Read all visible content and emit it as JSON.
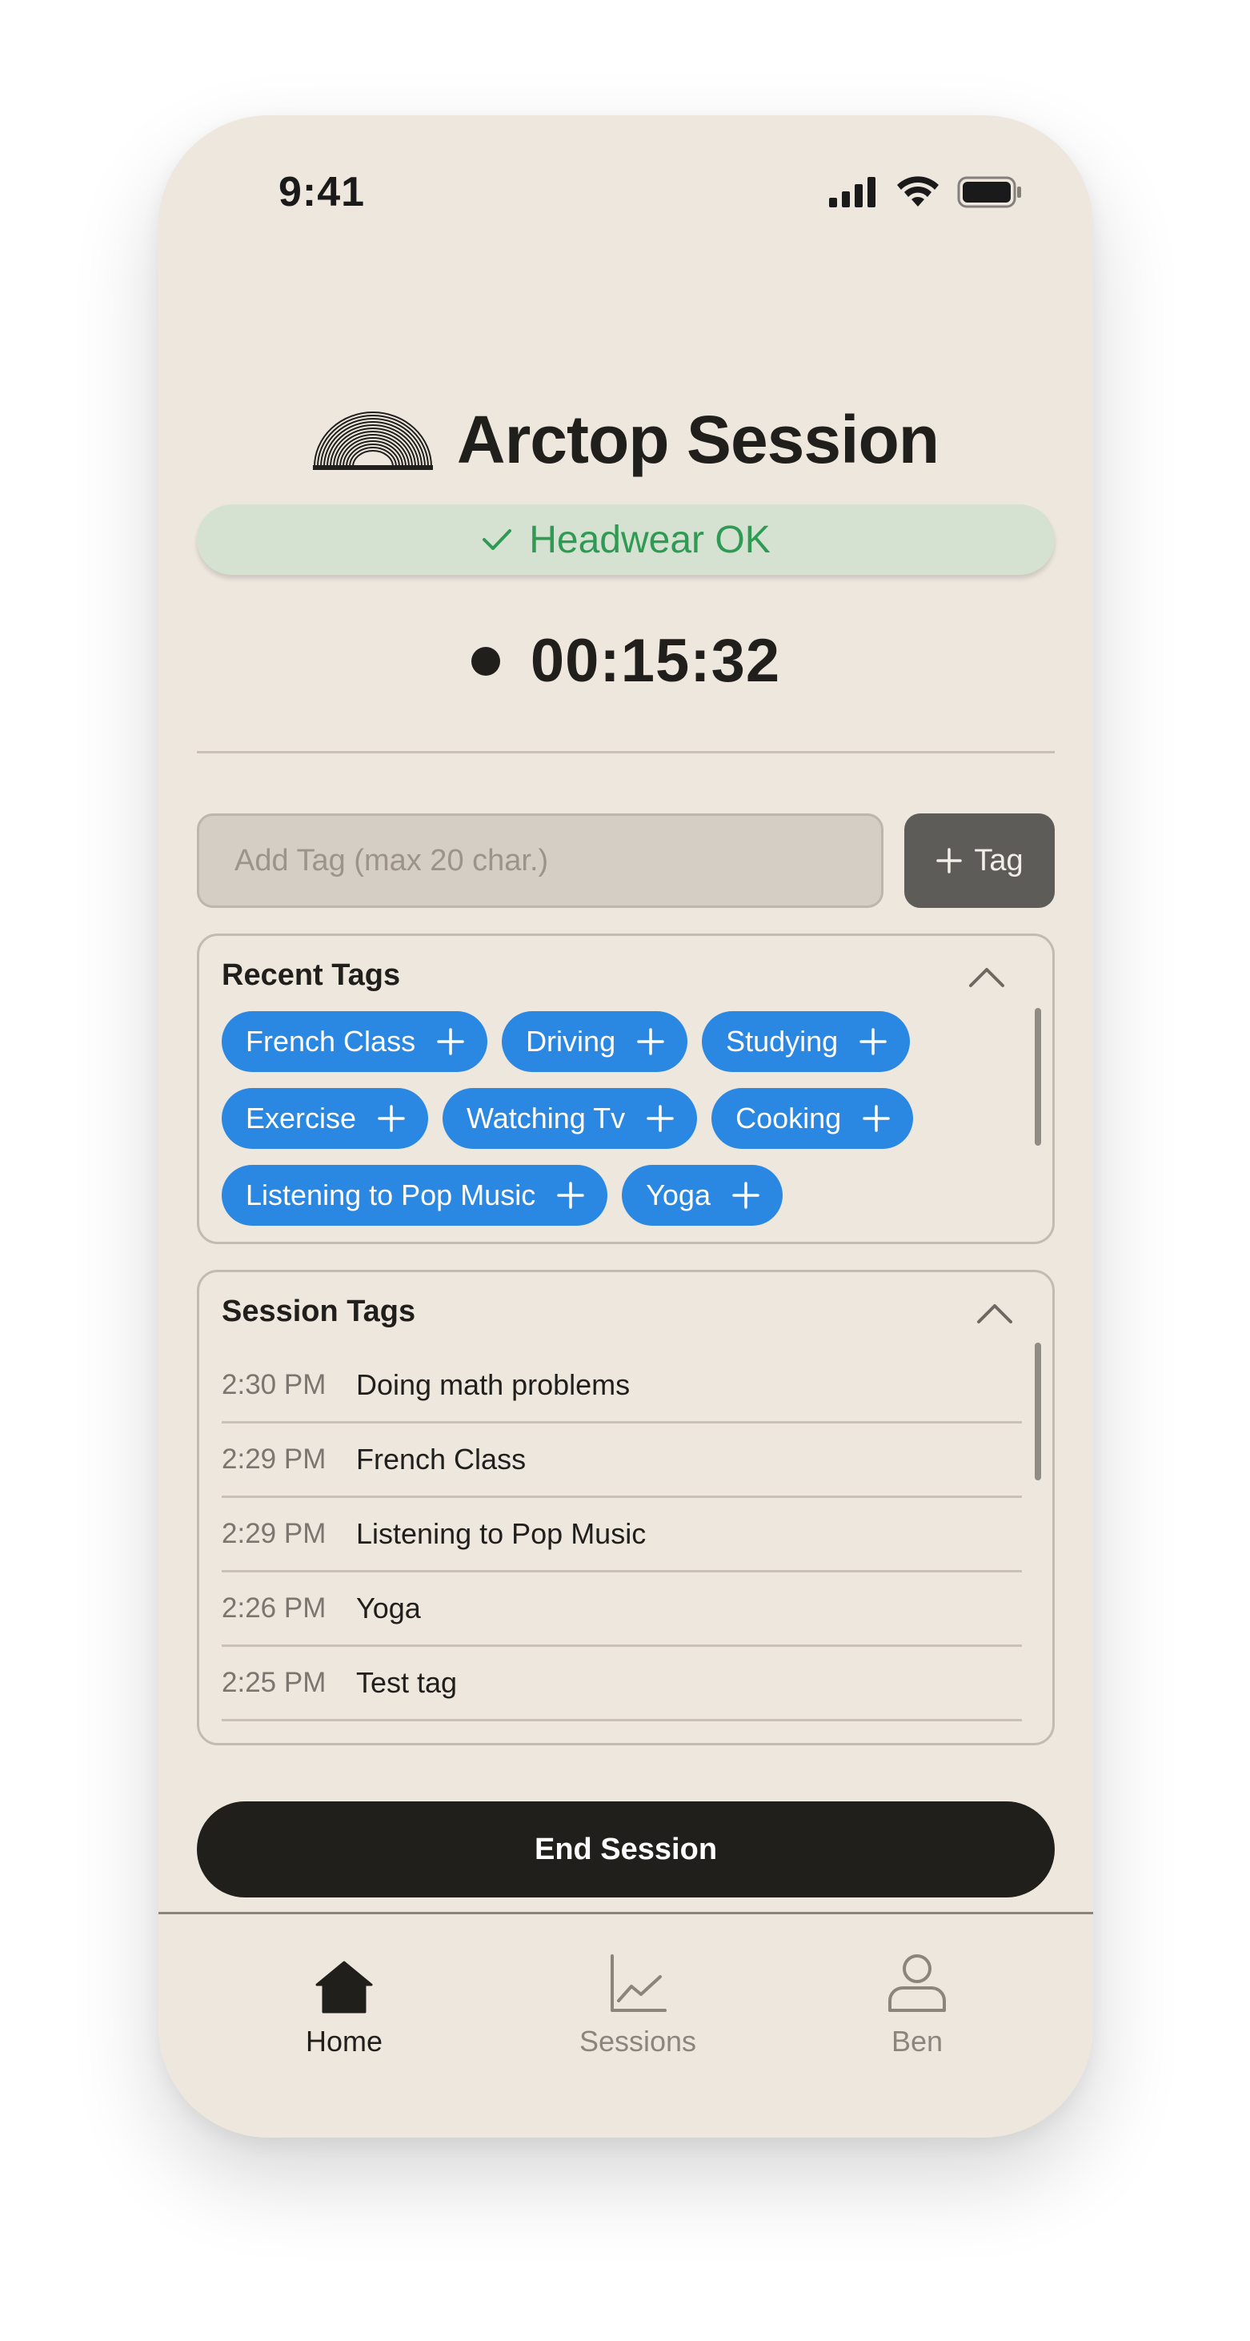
{
  "status_bar": {
    "time": "9:41",
    "icons": [
      "cellular-signal-icon",
      "wifi-icon",
      "battery-icon"
    ]
  },
  "header": {
    "logo": "arctop-logo",
    "title": "Arctop Session"
  },
  "headwear": {
    "icon": "checkmark-icon",
    "label": "Headwear OK",
    "color": "#2f9a53"
  },
  "timer": {
    "value": "00:15:32"
  },
  "tag_input": {
    "placeholder": "Add Tag (max 20 char.)",
    "value": "",
    "button_label": "Tag"
  },
  "recent_tags": {
    "title": "Recent Tags",
    "rows": [
      [
        {
          "label": "French Class"
        },
        {
          "label": "Driving"
        },
        {
          "label": "Studying"
        }
      ],
      [
        {
          "label": "Exercise"
        },
        {
          "label": "Watching Tv"
        },
        {
          "label": "Cooking"
        }
      ],
      [
        {
          "label": "Listening to Pop Music"
        },
        {
          "label": "Yoga"
        }
      ]
    ]
  },
  "session_tags": {
    "title": "Session Tags",
    "items": [
      {
        "time": "2:30 PM",
        "label": "Doing math problems"
      },
      {
        "time": "2:29 PM",
        "label": "French Class"
      },
      {
        "time": "2:29 PM",
        "label": "Listening to Pop Music"
      },
      {
        "time": "2:26 PM",
        "label": "Yoga"
      },
      {
        "time": "2:25 PM",
        "label": "Test tag"
      }
    ]
  },
  "end_session": {
    "label": "End Session"
  },
  "tabs": [
    {
      "label": "Home",
      "icon": "home-icon",
      "active": true
    },
    {
      "label": "Sessions",
      "icon": "chart-icon",
      "active": false
    },
    {
      "label": "Ben",
      "icon": "user-icon",
      "active": false
    }
  ],
  "colors": {
    "background": "#ede7de",
    "chip": "#2b88e2",
    "primary_dark": "#201f1c",
    "banner": "#d6e2d1"
  }
}
